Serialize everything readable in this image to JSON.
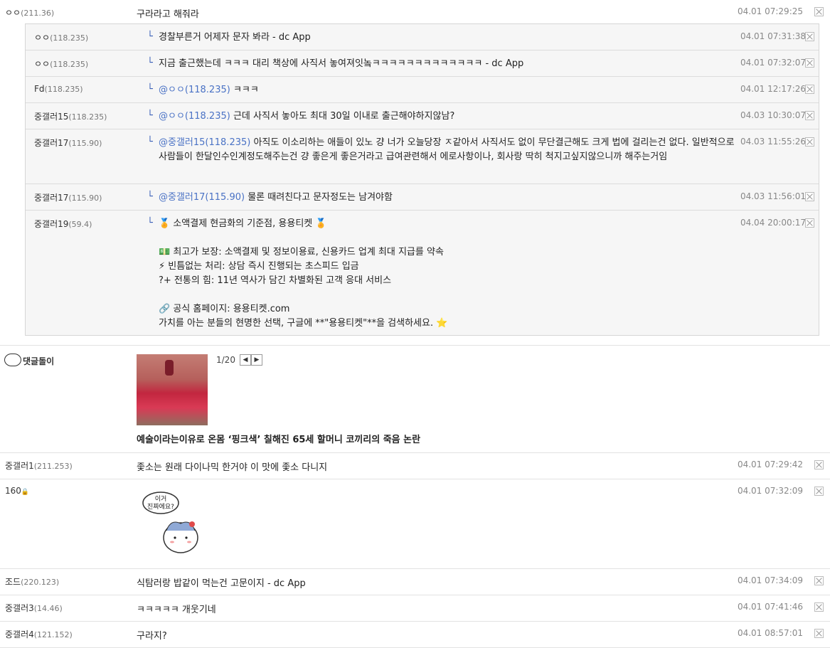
{
  "comments_top": {
    "nick": "ㅇㅇ",
    "ip": "(211.36)",
    "text": "구라라고 해줘라",
    "date": "04.01 07:29:25"
  },
  "replies": [
    {
      "nick": "ㅇㅇ",
      "ip": "(118.235)",
      "mention": "",
      "text": "경찰부른거 어제자 문자 봐라 - dc App",
      "date": "04.01 07:31:38"
    },
    {
      "nick": "ㅇㅇ",
      "ip": "(118.235)",
      "mention": "",
      "text": "지금 출근했는데 ㅋㅋㅋ 대리 책상에 사직서 놓여져잇놐ㅋㅋㅋㅋㅋㅋㅋㅋㅋㅋㅋㅋㅋ - dc App",
      "date": "04.01 07:32:07"
    },
    {
      "nick": "Fd",
      "ip": "(118.235)",
      "mention": "@ㅇㅇ(118.235)",
      "text": "ㅋㅋㅋ",
      "date": "04.01 12:17:26"
    },
    {
      "nick": "중갤러15",
      "ip": "(118.235)",
      "mention": "@ㅇㅇ(118.235)",
      "text": "근데 사직서 놓아도 최대 30일 이내로 출근해야하지않남?",
      "date": "04.03 10:30:07"
    },
    {
      "nick": "중갤러17",
      "ip": "(115.90)",
      "mention": "@중갤러15(118.235)",
      "text": "아직도 이소리하는 애들이 있노 걍 너가 오늘당장 ㅈ같아서 사직서도 없이 무단결근해도 크게 법에 걸리는건 없다. 일반적으로 사람들이 한달인수인계정도해주는건 걍 좋은게 좋은거라고 급여관련해서 에로사항이나, 회사랑 딱히 척지고싶지않으니까 해주는거임",
      "date": "04.03 11:55:26"
    },
    {
      "nick": "중갤러17",
      "ip": "(115.90)",
      "mention": "@중갤러17(115.90)",
      "text": "물론 때려친다고 문자정도는 남겨야함",
      "date": "04.03 11:56:01"
    },
    {
      "nick": "중갤러19",
      "ip": "(59.4)",
      "mention": "",
      "text": "",
      "date": "04.04 20:00:17",
      "lines": [
        "🏅 소액결제 현금화의 기준점, 용용티켓 🏅",
        "",
        "💵 최고가 보장: 소액결제 및 정보이용료, 신용카드 업계 최대 지급를 약속",
        "⚡ 빈틈없는 처리: 상담 즉시 진행되는 초스피드 입금",
        "?+ 전통의 힘: 11년 역사가 담긴 차별화된 고객 응대 서비스",
        "",
        "🔗 공식 홈페이지: 용용티켓.com",
        "가치를 아는 분들의 현명한 선택, 구글에 **\"용용티켓\"**을 검색하세요. ⭐"
      ]
    }
  ],
  "bot": {
    "nick": "댓글돌이",
    "pager": "1/20",
    "headline": "예술이라는이유로 온몸 ‘핑크색’ 칠해진 65세 할머니 코끼리의 죽음 논란"
  },
  "comments": [
    {
      "nick": "중갤러1",
      "ip": "(211.253)",
      "text": "좇소는 원래 다이나믹 한거야 이 맛에 좇소 다니지",
      "date": "04.01 07:29:42"
    },
    {
      "nick": "160",
      "ip": "",
      "text": "",
      "date": "04.01 07:32:09",
      "sticker": "이거 진짜에요?"
    },
    {
      "nick": "조드",
      "ip": "(220.123)",
      "text": "식탐러랑 밥같이 먹는건 고문이지 - dc App",
      "date": "04.01 07:34:09"
    },
    {
      "nick": "중갤러3",
      "ip": "(14.46)",
      "text": "ㅋㅋㅋㅋㅋ 개웃기네",
      "date": "04.01 07:41:46"
    },
    {
      "nick": "중갤러4",
      "ip": "(121.152)",
      "text": "구라지?",
      "date": "04.01 08:57:01"
    }
  ]
}
